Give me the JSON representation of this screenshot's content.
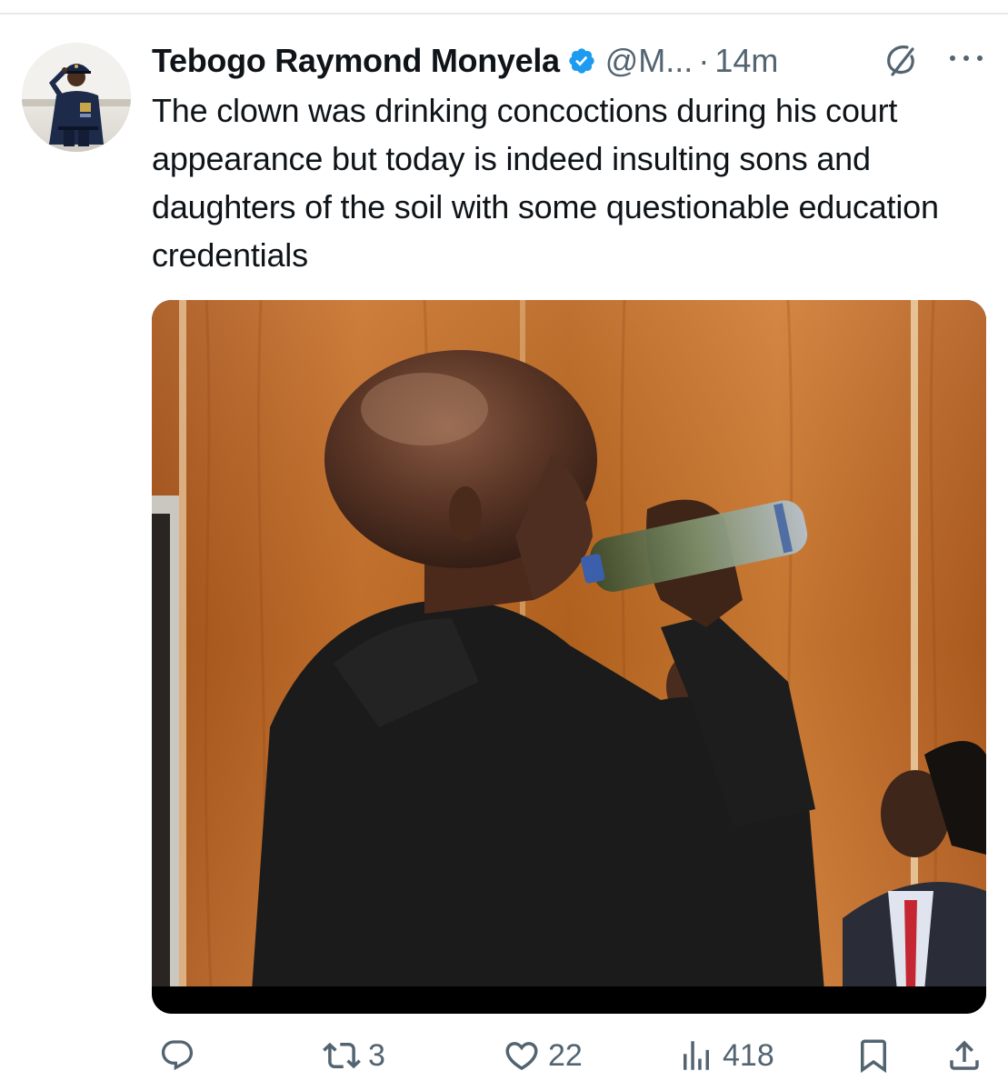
{
  "tweet": {
    "author": {
      "display_name": "Tebogo Raymond Monyela",
      "handle": "@M...",
      "verified": true,
      "avatar_icon": "avatar-saluting-officer"
    },
    "separator": "·",
    "timestamp": "14m",
    "text": "The clown was drinking concoctions during his court appearance but today is indeed insulting sons and daughters of the soil with some questionable education credentials",
    "media": {
      "type": "video-still"
    },
    "actions": {
      "reply": {
        "icon": "reply-icon",
        "count": ""
      },
      "retweet": {
        "icon": "retweet-icon",
        "count": "3"
      },
      "like": {
        "icon": "heart-icon",
        "count": "22"
      },
      "views": {
        "icon": "views-chart-icon",
        "count": "418"
      },
      "bookmark": {
        "icon": "bookmark-icon"
      },
      "share": {
        "icon": "share-icon"
      }
    }
  },
  "colors": {
    "text_primary": "#0f1419",
    "text_secondary": "#536471",
    "verified": "#1d9bf0",
    "divider": "#e6e8ea"
  }
}
